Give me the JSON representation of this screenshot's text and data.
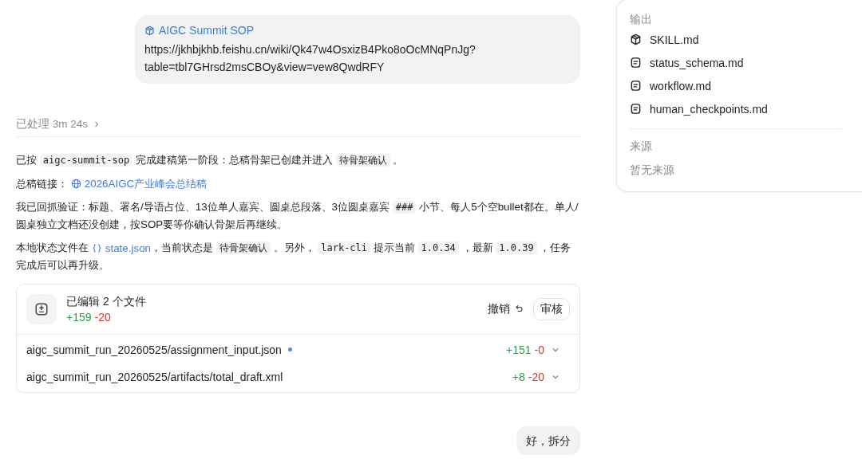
{
  "user_message": {
    "link_title": "AIGC Summit SOP",
    "url": "https://jkhbjkhb.feishu.cn/wiki/Qk47w4OsxizB4Pko8oOcMNqPnJg?table=tbl7GHrsd2msCBOy&view=vew8QwdRFY"
  },
  "process": {
    "label": "已处理 3m 24s",
    "expanded": false
  },
  "paragraphs": [
    [
      {
        "kind": "text",
        "text": "已按 "
      },
      {
        "kind": "code",
        "text": "aigc-summit-sop"
      },
      {
        "kind": "text",
        "text": " 完成建稿第一阶段：总稿骨架已创建并进入 "
      },
      {
        "kind": "code",
        "text": "待骨架确认"
      },
      {
        "kind": "text",
        "text": " 。"
      }
    ],
    [
      {
        "kind": "text",
        "text": "总稿链接： "
      },
      {
        "kind": "doc_link",
        "text": "2026AIGC产业峰会总结稿"
      }
    ],
    [
      {
        "kind": "text",
        "text": "我已回抓验证：标题、署名/导语占位、13位单人嘉宾、圆桌总段落、3位圆桌嘉宾 "
      },
      {
        "kind": "code",
        "text": "###"
      },
      {
        "kind": "text",
        "text": " 小节、每人5个空bullet都在。单人/圆桌独立文档还没创建，按SOP要等你确认骨架后再继续。"
      }
    ],
    [
      {
        "kind": "text",
        "text": "本地状态文件在 "
      },
      {
        "kind": "file_link",
        "text": "state.json"
      },
      {
        "kind": "text",
        "text": "，当前状态是 "
      },
      {
        "kind": "code",
        "text": "待骨架确认"
      },
      {
        "kind": "text",
        "text": " 。另外， "
      },
      {
        "kind": "code",
        "text": "lark-cli"
      },
      {
        "kind": "text",
        "text": " 提示当前 "
      },
      {
        "kind": "code",
        "text": "1.0.34"
      },
      {
        "kind": "text",
        "text": " ，最新 "
      },
      {
        "kind": "code",
        "text": "1.0.39"
      },
      {
        "kind": "text",
        "text": " ，任务完成后可以再升级。"
      }
    ]
  ],
  "edits": {
    "title": "已编辑 2 个文件",
    "added": "+159",
    "removed": "-20",
    "undo": "撤销",
    "review": "审核",
    "files": [
      {
        "path": "aigc_summit_run_20260525/assignment_input.json",
        "changed": true,
        "added": "+151",
        "removed": "-0",
        "expanded": false
      },
      {
        "path": "aigc_summit_run_20260525/artifacts/total_draft.xml",
        "changed": false,
        "added": "+8",
        "removed": "-20",
        "expanded": false
      }
    ]
  },
  "reply": "好，拆分",
  "side_panel": {
    "output_heading": "输出",
    "outputs": [
      {
        "kind": "skill",
        "name": "SKILL.md"
      },
      {
        "kind": "doc",
        "name": "status_schema.md"
      },
      {
        "kind": "doc",
        "name": "workflow.md"
      },
      {
        "kind": "doc",
        "name": "human_checkpoints.md"
      }
    ],
    "sources_heading": "来源",
    "sources_empty": "暂无来源"
  }
}
